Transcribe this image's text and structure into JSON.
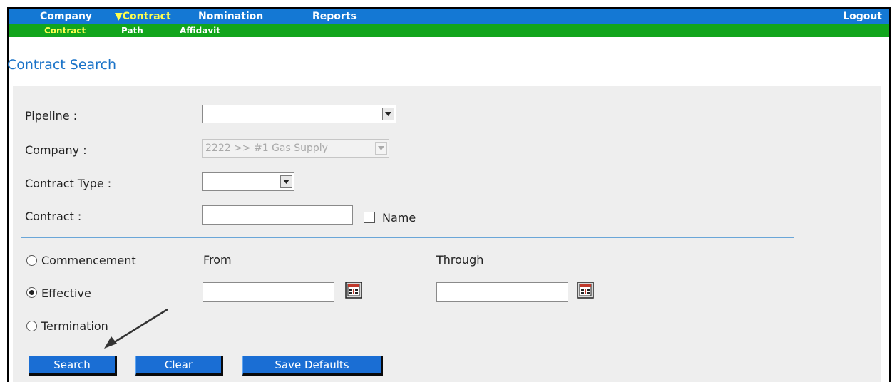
{
  "nav": {
    "main_items": [
      {
        "label": "Company"
      },
      {
        "label": "▼Contract"
      },
      {
        "label": "Nomination"
      },
      {
        "label": "Reports"
      }
    ],
    "logout_label": "Logout",
    "sub_items": [
      {
        "label": "Contract"
      },
      {
        "label": "Path"
      },
      {
        "label": "Affidavit"
      }
    ]
  },
  "page": {
    "title": "Contract Search"
  },
  "form": {
    "pipeline_label": "Pipeline :",
    "pipeline_value": "",
    "company_label": "Company :",
    "company_value": "2222 >> #1 Gas Supply",
    "contract_type_label": "Contract Type :",
    "contract_type_value": "",
    "contract_label": "Contract :",
    "contract_value": "",
    "name_checkbox_label": "Name",
    "name_checked": false
  },
  "dates": {
    "from_label": "From",
    "through_label": "Through",
    "from_value": "",
    "through_value": "",
    "options": [
      {
        "label": "Commencement",
        "selected": false
      },
      {
        "label": "Effective",
        "selected": true
      },
      {
        "label": "Termination",
        "selected": false
      }
    ]
  },
  "buttons": {
    "search_label": "Search",
    "clear_label": "Clear",
    "save_defaults_label": "Save Defaults"
  },
  "colors": {
    "nav_blue": "#1478d4",
    "nav_green": "#12a51d",
    "active_yellow": "#ffff4d",
    "title_blue": "#1a73c8",
    "button_blue": "#1a6ed4"
  },
  "icons": {
    "calendar": "calendar-icon",
    "dropdown": "chevron-down-icon",
    "annotation": "arrow-annotation-icon"
  }
}
